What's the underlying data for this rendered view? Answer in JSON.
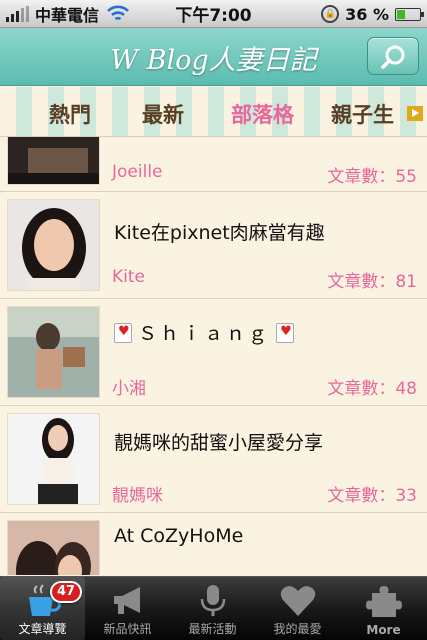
{
  "status": {
    "carrier": "中華電信",
    "time": "下午7:00",
    "battery": "36 %",
    "battery_fraction": 0.36
  },
  "header": {
    "title": "W Blog人妻日記"
  },
  "tabs": [
    {
      "label": "熱門"
    },
    {
      "label": "最新"
    },
    {
      "label": "部落格"
    },
    {
      "label": "親子生"
    }
  ],
  "list": {
    "items": [
      {
        "title": "",
        "author": "Joeille",
        "count": "文章數：55"
      },
      {
        "title": "Kite在pixnet肉麻當有趣",
        "author": "Kite",
        "count": "文章數：81"
      },
      {
        "title": "Ｓｈｉａｎｇ",
        "author": "小湘",
        "count": "文章數：48"
      },
      {
        "title": "靚媽咪的甜蜜小屋愛分享",
        "author": "靚媽咪",
        "count": "文章數：33"
      },
      {
        "title": "At CoZyHoMe",
        "author": "",
        "count": ""
      }
    ]
  },
  "tabbar": {
    "items": [
      {
        "label": "文章導覽",
        "badge": "47"
      },
      {
        "label": "新品快訊"
      },
      {
        "label": "最新活動"
      },
      {
        "label": "我的最愛"
      },
      {
        "label": "More"
      }
    ]
  }
}
